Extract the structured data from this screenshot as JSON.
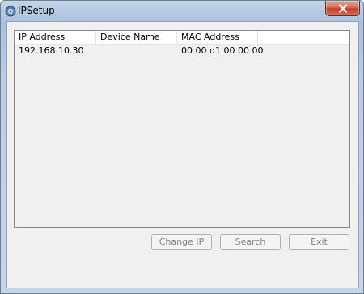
{
  "window": {
    "title": "IPSetup"
  },
  "icons": {
    "app": "ipsetup-app-icon",
    "close": "close-icon"
  },
  "list": {
    "columns": [
      "IP Address",
      "Device Name",
      "MAC Address",
      ""
    ],
    "rows": [
      {
        "ip": "192.168.10.30",
        "device_name": "",
        "mac": "00 00 d1 00 00 00"
      }
    ]
  },
  "buttons": {
    "change_ip": "Change IP",
    "search": "Search",
    "exit": "Exit"
  },
  "colors": {
    "close_button": "#c9503c",
    "client_bg": "#f0f0f0",
    "disabled_text": "#838383"
  }
}
